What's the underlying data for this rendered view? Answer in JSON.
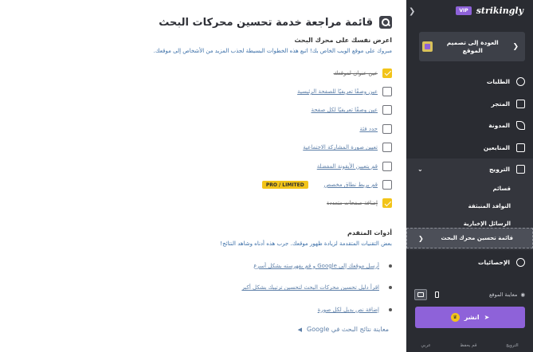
{
  "main": {
    "title": "قائمة مراجعة خدمة تحسين محركات البحث",
    "subtitle": "اعرض نفسك على محرك البحث",
    "intro": "مبروك على موقع الويب الخاص بك! اتبع هذه الخطوات البسيطة لجذب المزيد من الأشخاص إلى موقعك.",
    "checklist": [
      {
        "label": "عين عنوان لموقعك",
        "checked": true
      },
      {
        "label": "عين وصفًا تعريفيًا للصفحة الرئيسية",
        "checked": false
      },
      {
        "label": "عين وصفًا تعريفيًا لكل صفحة",
        "checked": false
      },
      {
        "label": "حدد فئة",
        "checked": false
      },
      {
        "label": "تعيين صورة المشاركة الاجتماعية",
        "checked": false
      },
      {
        "label": "قم بتعيين الأيقونة المفضلة",
        "checked": false
      },
      {
        "label": "قم بربط نطاق مخصص",
        "checked": false,
        "badge": "PRO / LIMITED"
      },
      {
        "label": "إضافة صفحات متعددة",
        "checked": true
      }
    ],
    "advanced_title": "أدوات المتقدم",
    "advanced_desc": "بعض التقنيات المتقدمة لزيادة ظهور موقعك. جرب هذه أدناه وشاهد النتائج!",
    "tools": [
      "أرسل موقعك إلى Google و قم بفهرسته بشكل أسرع",
      "اقرأ دليل تحسين محركات البحث لتحسين ترتيبك بشكل أكبر",
      "إضافة نص بديل لكل صورة"
    ],
    "google_preview": "معاينة نتائج البحث في Google"
  },
  "sidebar": {
    "brand": "strikingly",
    "vip": "VIP",
    "back_label": "العودة إلى تصميم الموقع",
    "nav": [
      {
        "label": "الطلبات",
        "icon": "dollar-circle-icon"
      },
      {
        "label": "المتجر",
        "icon": "store-icon"
      },
      {
        "label": "المدونة",
        "icon": "pen-icon"
      },
      {
        "label": "المتابعين",
        "icon": "users-icon"
      }
    ],
    "section": {
      "label": "الترويج",
      "icon": "megaphone-icon",
      "items": [
        "قسائم",
        "النوافذ المنبثقة",
        "الرسائل الإخبارية"
      ],
      "active": "قائمة تحسين محرك البحث"
    },
    "stats_label": "الإحصائيات",
    "preview_label": "معاينة الموقع",
    "publish_label": "انشر",
    "footer": [
      "الترويج",
      "قم بحفظ",
      "عربي"
    ]
  },
  "colors": {
    "sidebar_bg": "#2a2c32",
    "accent_purple": "#8e62d9",
    "checkbox_yellow": "#f2c419",
    "link_blue": "#5d7fa8"
  }
}
